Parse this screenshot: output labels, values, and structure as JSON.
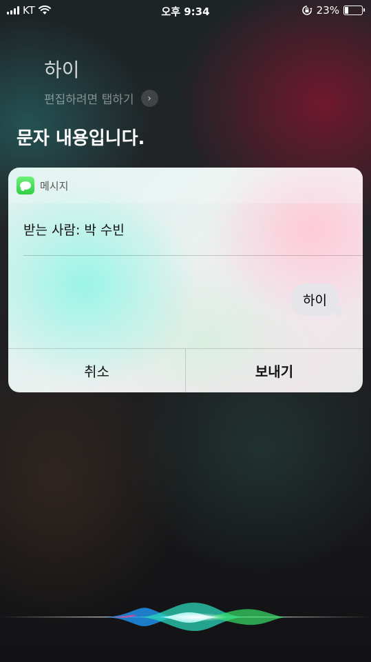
{
  "status_bar": {
    "carrier": "KT",
    "time": "오후 9:34",
    "battery_percent": "23%",
    "battery_level": 0.23,
    "signal_icon": "signal-bars-icon",
    "wifi_icon": "wifi-icon",
    "rotation_lock_icon": "rotation-lock-icon"
  },
  "siri": {
    "query": "하이",
    "edit_hint": "편집하려면 탭하기",
    "response": "문자 내용입니다."
  },
  "message_card": {
    "app_name": "메시지",
    "recipient": "받는 사람: 박 수빈",
    "message_text": "하이",
    "cancel_label": "취소",
    "send_label": "보내기"
  },
  "colors": {
    "app_icon_green": "#34c759",
    "bubble_gray": "#e5e5ea"
  }
}
